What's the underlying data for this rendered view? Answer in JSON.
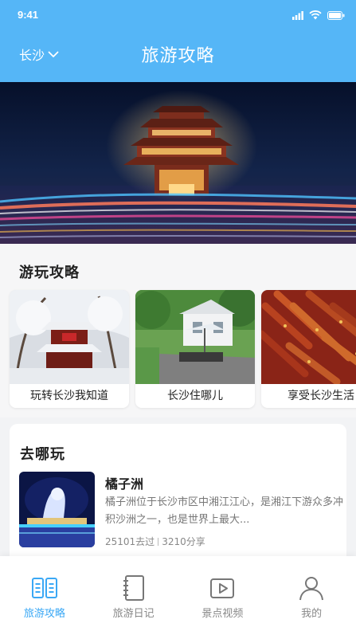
{
  "status_bar": {
    "time": "9:41"
  },
  "header": {
    "city": "长沙",
    "title": "旅游攻略"
  },
  "guides": {
    "title": "游玩攻略",
    "cards": [
      {
        "label": "玩转长沙我知道"
      },
      {
        "label": "长沙住哪儿"
      },
      {
        "label": "享受长沙生活"
      }
    ]
  },
  "where": {
    "title": "去哪玩",
    "place": {
      "name": "橘子洲",
      "description": "橘子洲位于长沙市区中湘江江心，是湘江下游众多冲积沙洲之一，也是世界上最大...",
      "visits": "25101去过",
      "shares": "3210分享"
    }
  },
  "tabbar": {
    "tabs": [
      {
        "label": "旅游攻略",
        "icon": "book-open-icon",
        "active": true
      },
      {
        "label": "旅游日记",
        "icon": "notebook-icon",
        "active": false
      },
      {
        "label": "景点视频",
        "icon": "video-play-icon",
        "active": false
      },
      {
        "label": "我的",
        "icon": "user-profile-icon",
        "active": false
      }
    ]
  },
  "colors": {
    "primary": "#55b6f7",
    "active_tab": "#3aa8f5",
    "background": "#f2f3f5"
  }
}
